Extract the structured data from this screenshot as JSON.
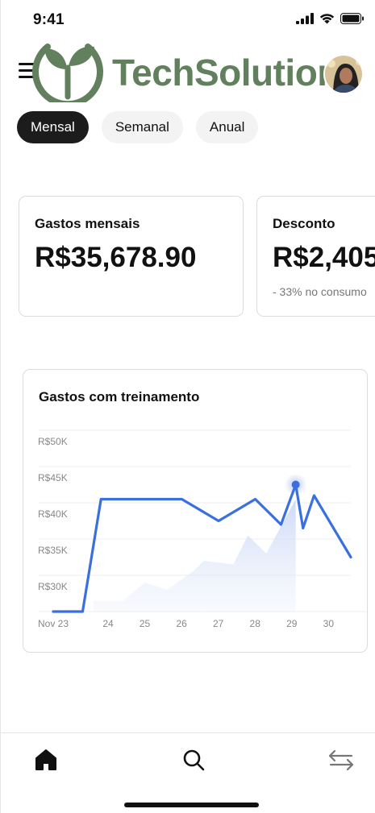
{
  "status_bar": {
    "time": "9:41"
  },
  "header": {
    "logo_text": "TechSolutions",
    "logo_color": "#62805d"
  },
  "tabs": [
    {
      "label": "Mensal",
      "active": true
    },
    {
      "label": "Semanal",
      "active": false
    },
    {
      "label": "Anual",
      "active": false
    }
  ],
  "cards": [
    {
      "title": "Gastos mensais",
      "value": "R$35,678.90",
      "sub": ""
    },
    {
      "title": "Desconto",
      "value": "R$2,405",
      "sub": "- 33% no consumo"
    }
  ],
  "chart_card": {
    "title": "Gastos com treinamento"
  },
  "chart_data": {
    "type": "line",
    "title": "Gastos com treinamento",
    "y_ticks": [
      "R$50K",
      "R$45K",
      "R$40K",
      "R$35K",
      "R$30K"
    ],
    "x_ticks": [
      "Nov 23",
      "24",
      "25",
      "26",
      "27",
      "28",
      "29",
      "30"
    ],
    "ylim": [
      25000,
      50000
    ],
    "grid": true,
    "accent_color": "#3a6fe0",
    "series": [
      {
        "x": [
          22.5,
          23.3,
          23.8,
          25.0,
          26.0,
          27.0,
          28.0,
          28.7,
          29.1,
          29.3,
          29.6,
          30.6
        ],
        "values": [
          25000,
          25000,
          40500,
          40500,
          40500,
          37500,
          40500,
          37000,
          42500,
          36500,
          41000,
          32500
        ]
      }
    ],
    "highlight_point": {
      "x": 29.1,
      "value": 42500
    },
    "background_area": {
      "x": [
        23.6,
        24.4,
        25.0,
        25.6,
        26.3,
        26.6,
        27.4,
        27.8,
        28.3,
        29.1,
        29.1
      ],
      "values": [
        26500,
        26500,
        29000,
        28000,
        30500,
        32000,
        31500,
        35500,
        33000,
        40500,
        25000
      ]
    }
  },
  "bottom_nav": [
    {
      "icon": "home-icon",
      "active": true
    },
    {
      "icon": "search-icon",
      "active": false
    },
    {
      "icon": "transfer-icon",
      "active": false
    }
  ]
}
